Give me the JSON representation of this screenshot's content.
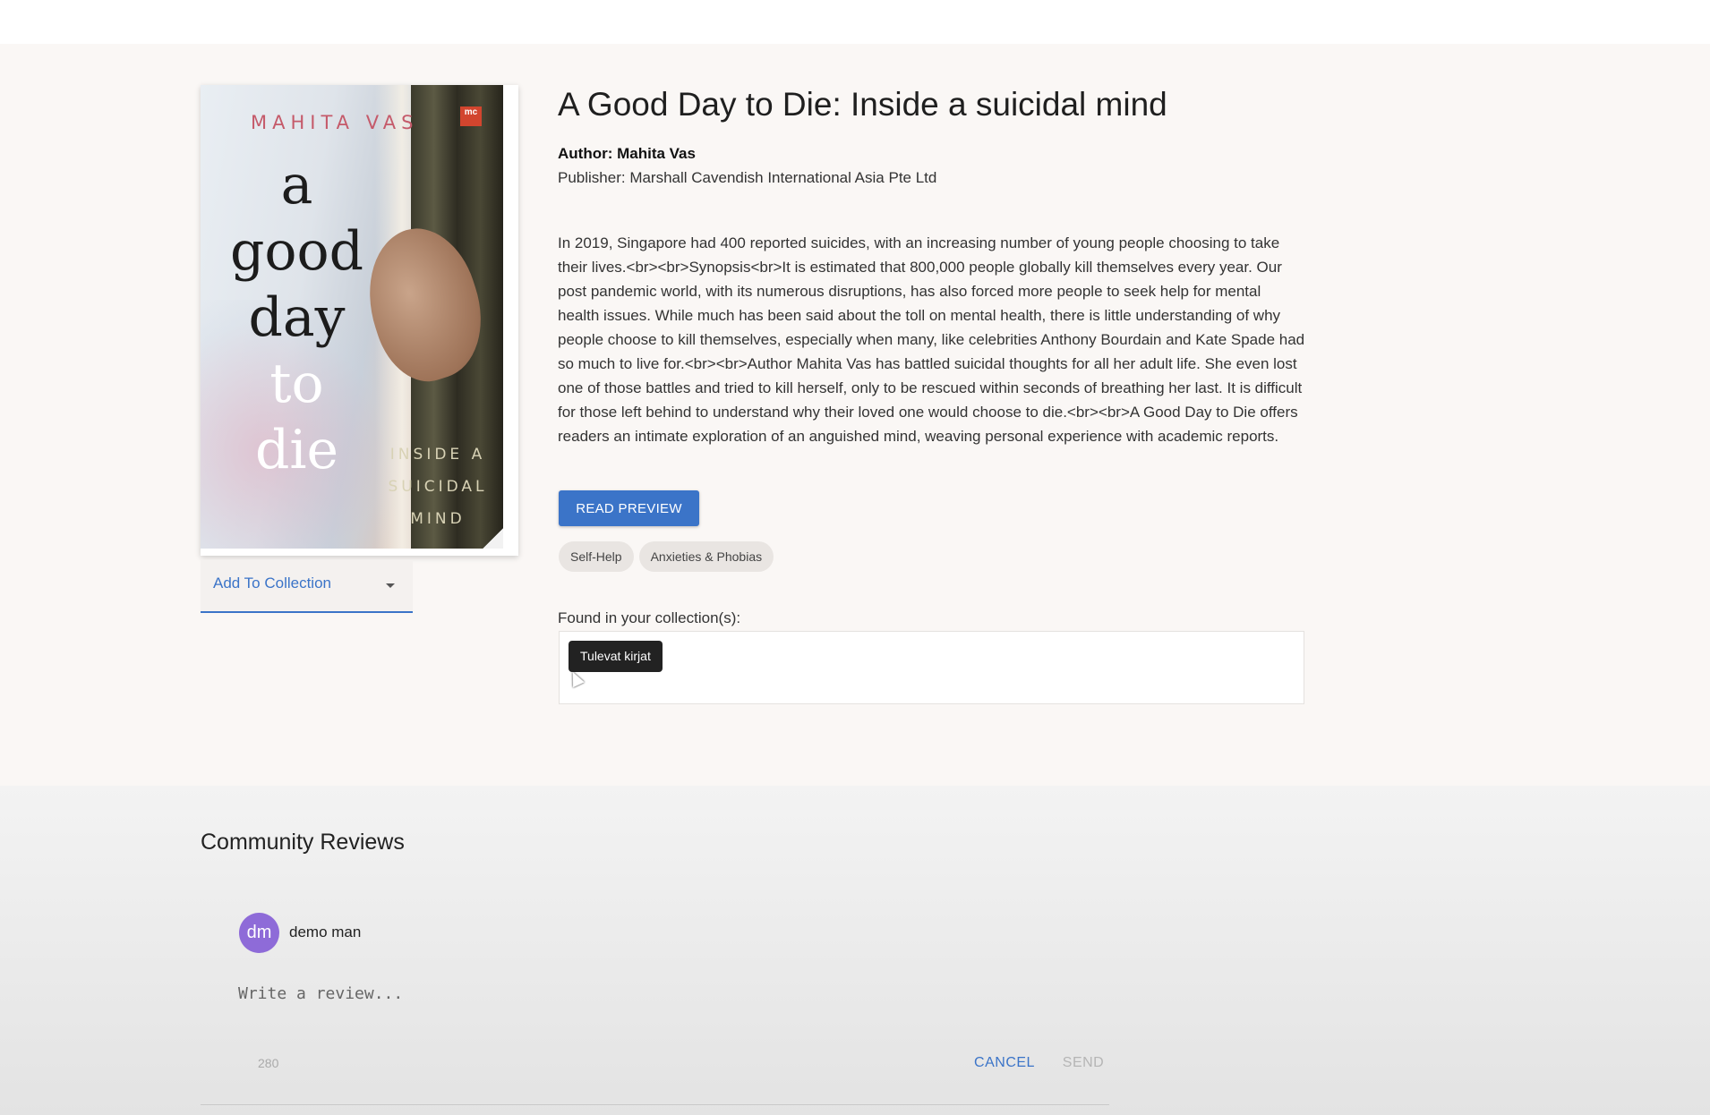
{
  "book": {
    "title": "A Good Day to Die: Inside a suicidal mind",
    "author": "Author: Mahita Vas",
    "publisher": "Publisher: Marshall Cavendish International Asia Pte Ltd",
    "description": "In 2019, Singapore had 400 reported suicides, with an increasing number of young people choosing to take their lives.<br><br>Synopsis<br>It is estimated that 800,000 people globally kill themselves every year. Our post pandemic world, with its numerous disruptions, has also forced more people to seek help for mental health issues. While much has been said about the toll on mental health, there is little understanding of why people choose to kill themselves, especially when many, like celebrities Anthony Bourdain and Kate Spade had so much to live for.<br><br>Author Mahita Vas has battled suicidal thoughts for all her adult life. She even lost one of those battles and tried to kill herself, only to be rescued within seconds of breathing her last. It is difficult for those left behind to understand why their loved one would choose to die.<br><br>A Good Day to Die offers readers an intimate exploration of an anguished mind, weaving personal experience with academic reports.",
    "read_preview_label": "READ PREVIEW",
    "tags": [
      "Self-Help",
      "Anxieties & Phobias"
    ]
  },
  "cover": {
    "author_text": "MAHITA VAS",
    "logo_text": "mc",
    "title_words": [
      "a",
      "good",
      "day",
      "to",
      "die"
    ],
    "subtitle_lines": [
      "INSIDE A",
      "SUICIDAL",
      "MIND"
    ]
  },
  "collection": {
    "select_label": "Add To Collection",
    "found_label": "Found in your collection(s):",
    "chips": [
      "Tulevat kirjat"
    ]
  },
  "reviews": {
    "title": "Community Reviews",
    "avatar_initials": "dm",
    "avatar_color": "#8e6bd8",
    "reviewer_name": "demo man",
    "input_placeholder": "Write a review...",
    "char_counter": "280",
    "cancel_label": "CANCEL",
    "send_label": "SEND"
  },
  "colors": {
    "accent": "#3b74c8",
    "chip_dark": "#222222"
  }
}
